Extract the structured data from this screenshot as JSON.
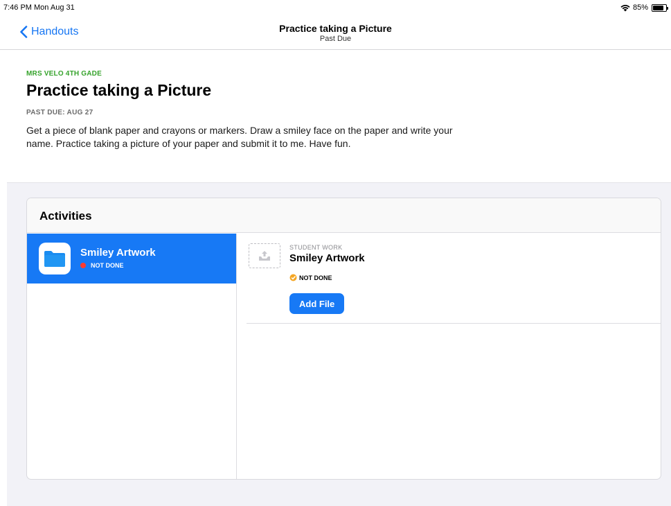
{
  "status_bar": {
    "time": "7:46 PM  Mon Aug 31",
    "battery": "85%",
    "icons": [
      "wifi-icon",
      "battery-icon"
    ]
  },
  "nav": {
    "back_label": "Handouts",
    "title": "Practice taking a Picture",
    "subtitle": "Past Due",
    "back_icon": "chevron-left-icon"
  },
  "assignment": {
    "class_name": "MRS VELO 4TH GADE",
    "title": "Practice taking a Picture",
    "due": "PAST DUE: AUG 27",
    "instructions": "Get a piece of blank paper and crayons or markers. Draw a smiley face on the paper and write your name. Practice taking a picture of your paper and submit it to me. Have fun."
  },
  "activities": {
    "header": "Activities",
    "items": [
      {
        "name": "Smiley Artwork",
        "status": "NOT DONE",
        "icon": "files-app-icon",
        "status_color": "#ff3b30",
        "selected": true
      }
    ]
  },
  "detail": {
    "label": "STUDENT WORK",
    "title": "Smiley Artwork",
    "status": "NOT DONE",
    "status_icon": "not-done-icon",
    "thumb_icon": "upload-tray-icon",
    "add_button": "Add File"
  },
  "colors": {
    "accent": "#1779f5",
    "class_green": "#36a32c",
    "background": "#f2f2f7"
  }
}
